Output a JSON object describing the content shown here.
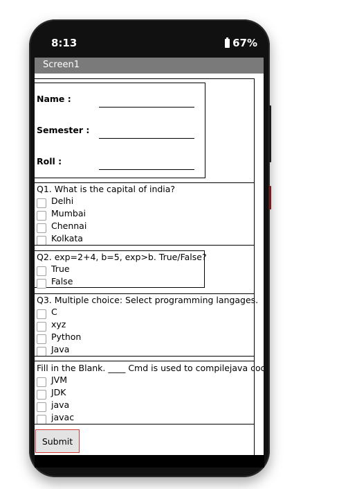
{
  "status_bar": {
    "time": "8:13",
    "battery_percent": "67%",
    "battery_icon": "battery-icon"
  },
  "app": {
    "title": "Screen1"
  },
  "student_info": {
    "name_label": "Name :",
    "name_value": "",
    "semester_label": "Semester :",
    "semester_value": "",
    "roll_label": "Roll :",
    "roll_value": ""
  },
  "questions": [
    {
      "text": "Q1. What is the capital of india?",
      "options": [
        "Delhi",
        "Mumbai",
        "Chennai",
        "Kolkata"
      ]
    },
    {
      "text": "Q2. exp=2+4, b=5, exp>b. True/False?",
      "options": [
        "True",
        "False"
      ]
    },
    {
      "text": "Q3. Multiple choice: Select programming langages.",
      "options": [
        "C",
        "xyz",
        "Python",
        "Java"
      ]
    },
    {
      "text": "Fill in the Blank. ____ Cmd is used to compilejava code",
      "options": [
        "JVM",
        "JDK",
        "java",
        "javac"
      ]
    }
  ],
  "submit_label": "Submit",
  "colors": {
    "titlebar": "#7a7a7a",
    "submit_border": "#d33a3a",
    "submit_bg": "#e3e3e3"
  }
}
